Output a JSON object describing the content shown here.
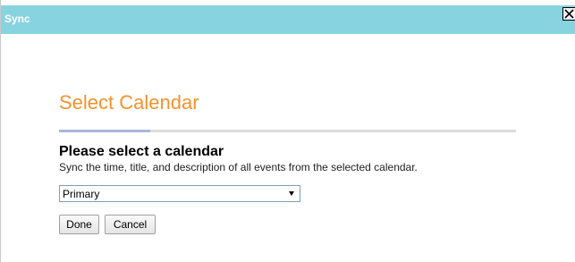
{
  "window": {
    "title": "Sync",
    "close_icon": "close-x-icon"
  },
  "dialog": {
    "heading": "Select Calendar",
    "progress_fraction": 0.2,
    "subheading": "Please select a calendar",
    "description": "Sync the time, title, and description of all events from the selected calendar.",
    "calendar_select": {
      "selected": "Primary"
    },
    "buttons": {
      "done": "Done",
      "cancel": "Cancel"
    }
  },
  "colors": {
    "titlebar": "#87d3e0",
    "heading": "#f5922b",
    "progress_fill": "#aab6dc",
    "progress_track": "#dcdcdc"
  }
}
